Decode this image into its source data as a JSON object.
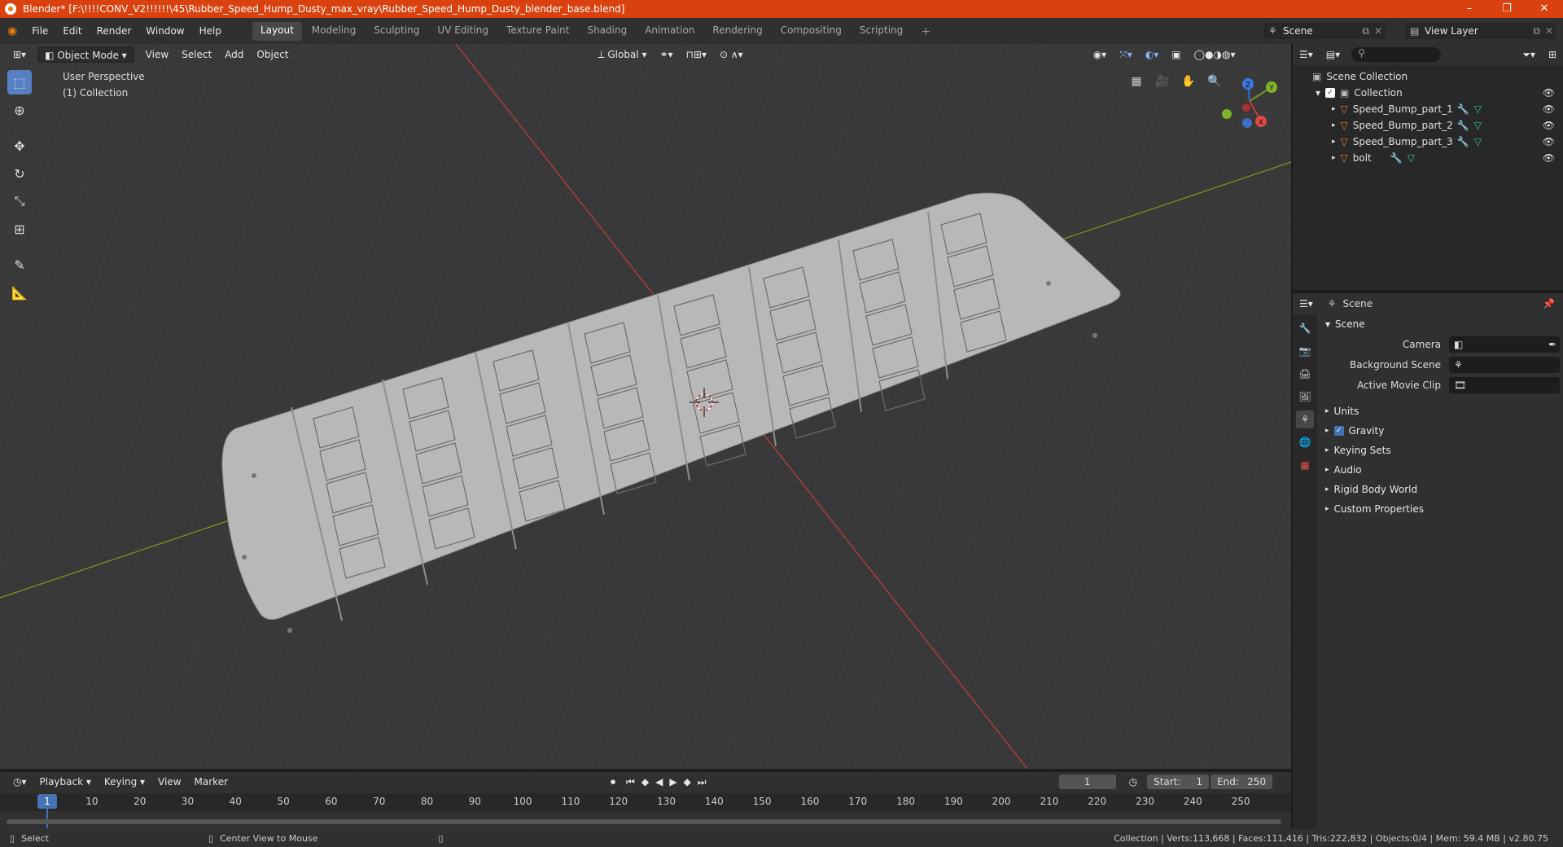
{
  "title": "Blender* [F:\\!!!!CONV_V2!!!!!!\\45\\Rubber_Speed_Hump_Dusty_max_vray\\Rubber_Speed_Hump_Dusty_blender_base.blend]",
  "menu": [
    "File",
    "Edit",
    "Render",
    "Window",
    "Help"
  ],
  "workspaces": [
    "Layout",
    "Modeling",
    "Sculpting",
    "UV Editing",
    "Texture Paint",
    "Shading",
    "Animation",
    "Rendering",
    "Compositing",
    "Scripting"
  ],
  "active_workspace": "Layout",
  "scene_name": "Scene",
  "view_layer": "View Layer",
  "viewport": {
    "mode": "Object Mode",
    "menus": [
      "View",
      "Select",
      "Add",
      "Object"
    ],
    "orientation": "Global",
    "overlay_title": "User Perspective",
    "overlay_collection": "(1) Collection",
    "gizmo": {
      "x": "X",
      "y": "Y",
      "z": "Z"
    }
  },
  "outliner": {
    "root": "Scene Collection",
    "collection": "Collection",
    "items": [
      "Speed_Bump_part_1",
      "Speed_Bump_part_2",
      "Speed_Bump_part_3",
      "bolt"
    ]
  },
  "properties": {
    "header": "Scene",
    "section": "Scene",
    "fields": [
      {
        "label": "Camera"
      },
      {
        "label": "Background Scene"
      },
      {
        "label": "Active Movie Clip"
      }
    ],
    "subsections": [
      "Units",
      "Gravity",
      "Keying Sets",
      "Audio",
      "Rigid Body World",
      "Custom Properties"
    ]
  },
  "timeline": {
    "menus": [
      "Playback",
      "Keying",
      "View",
      "Marker"
    ],
    "current_frame": "1",
    "start_label": "Start:",
    "start": "1",
    "end_label": "End:",
    "end": "250",
    "ticks": [
      "1",
      "10",
      "20",
      "30",
      "40",
      "50",
      "60",
      "70",
      "80",
      "90",
      "100",
      "110",
      "120",
      "130",
      "140",
      "150",
      "160",
      "170",
      "180",
      "190",
      "200",
      "210",
      "220",
      "230",
      "240",
      "250"
    ]
  },
  "status": {
    "left": "Select",
    "middle": "Center View to Mouse",
    "right": "Collection | Verts:113,668 | Faces:111,416 | Tris:222,832 | Objects:0/4 | Mem: 59.4 MB | v2.80.75"
  },
  "window_controls": [
    "–",
    "❐",
    "✕"
  ],
  "colors": {
    "accent": "#5680c2",
    "titlebar": "#d9420e",
    "x_axis": "#c43c3c",
    "y_axis": "#7a9a1e"
  }
}
